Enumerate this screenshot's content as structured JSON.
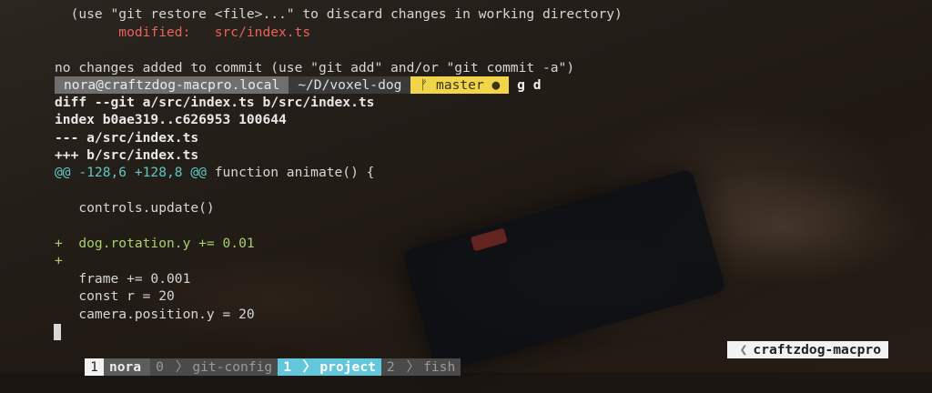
{
  "terminal": {
    "lines": {
      "restore_hint": "  (use \"git restore <file>...\" to discard changes in working directory)",
      "modified_label": "modified:",
      "modified_file": "src/index.ts",
      "no_changes": "no changes added to commit (use \"git add\" and/or \"git commit -a\")",
      "diff_header": "diff --git a/src/index.ts b/src/index.ts",
      "index_line": "index b0ae319..c626953 100644",
      "minus_file": "--- a/src/index.ts",
      "plus_file": "+++ b/src/index.ts",
      "hunk_range": "@@ -128,6 +128,8 @@",
      "hunk_context": " function animate() {",
      "ctx_controls": "   controls.update()",
      "add_rotation": "+  dog.rotation.y += 0.01",
      "add_blank": "+",
      "ctx_frame": "   frame += 0.001",
      "ctx_const": "   const r = 20",
      "ctx_camera": "   camera.position.y = 20"
    },
    "prompt": {
      "user_host": "nora@craftzdog-macpro.local",
      "path": "~/D/voxel-dog",
      "branch_icon": "ᚠ",
      "branch": "master",
      "dirty_dot": "●",
      "command": "g d"
    }
  },
  "tmux": {
    "session_number": "1",
    "session_name": "nora",
    "windows": [
      {
        "index": "0",
        "name": "git-config",
        "active": false
      },
      {
        "index": "1",
        "name": "project",
        "active": true
      },
      {
        "index": "2",
        "name": "fish",
        "active": false
      }
    ],
    "separator": "〉",
    "hostname": "craftzdog-macpro"
  },
  "colors": {
    "diff_add": "#a9d16e",
    "hunk": "#5fc9c2",
    "modified": "#e7645a",
    "git_segment": "#f0d44a",
    "active_window": "#62c7da"
  }
}
